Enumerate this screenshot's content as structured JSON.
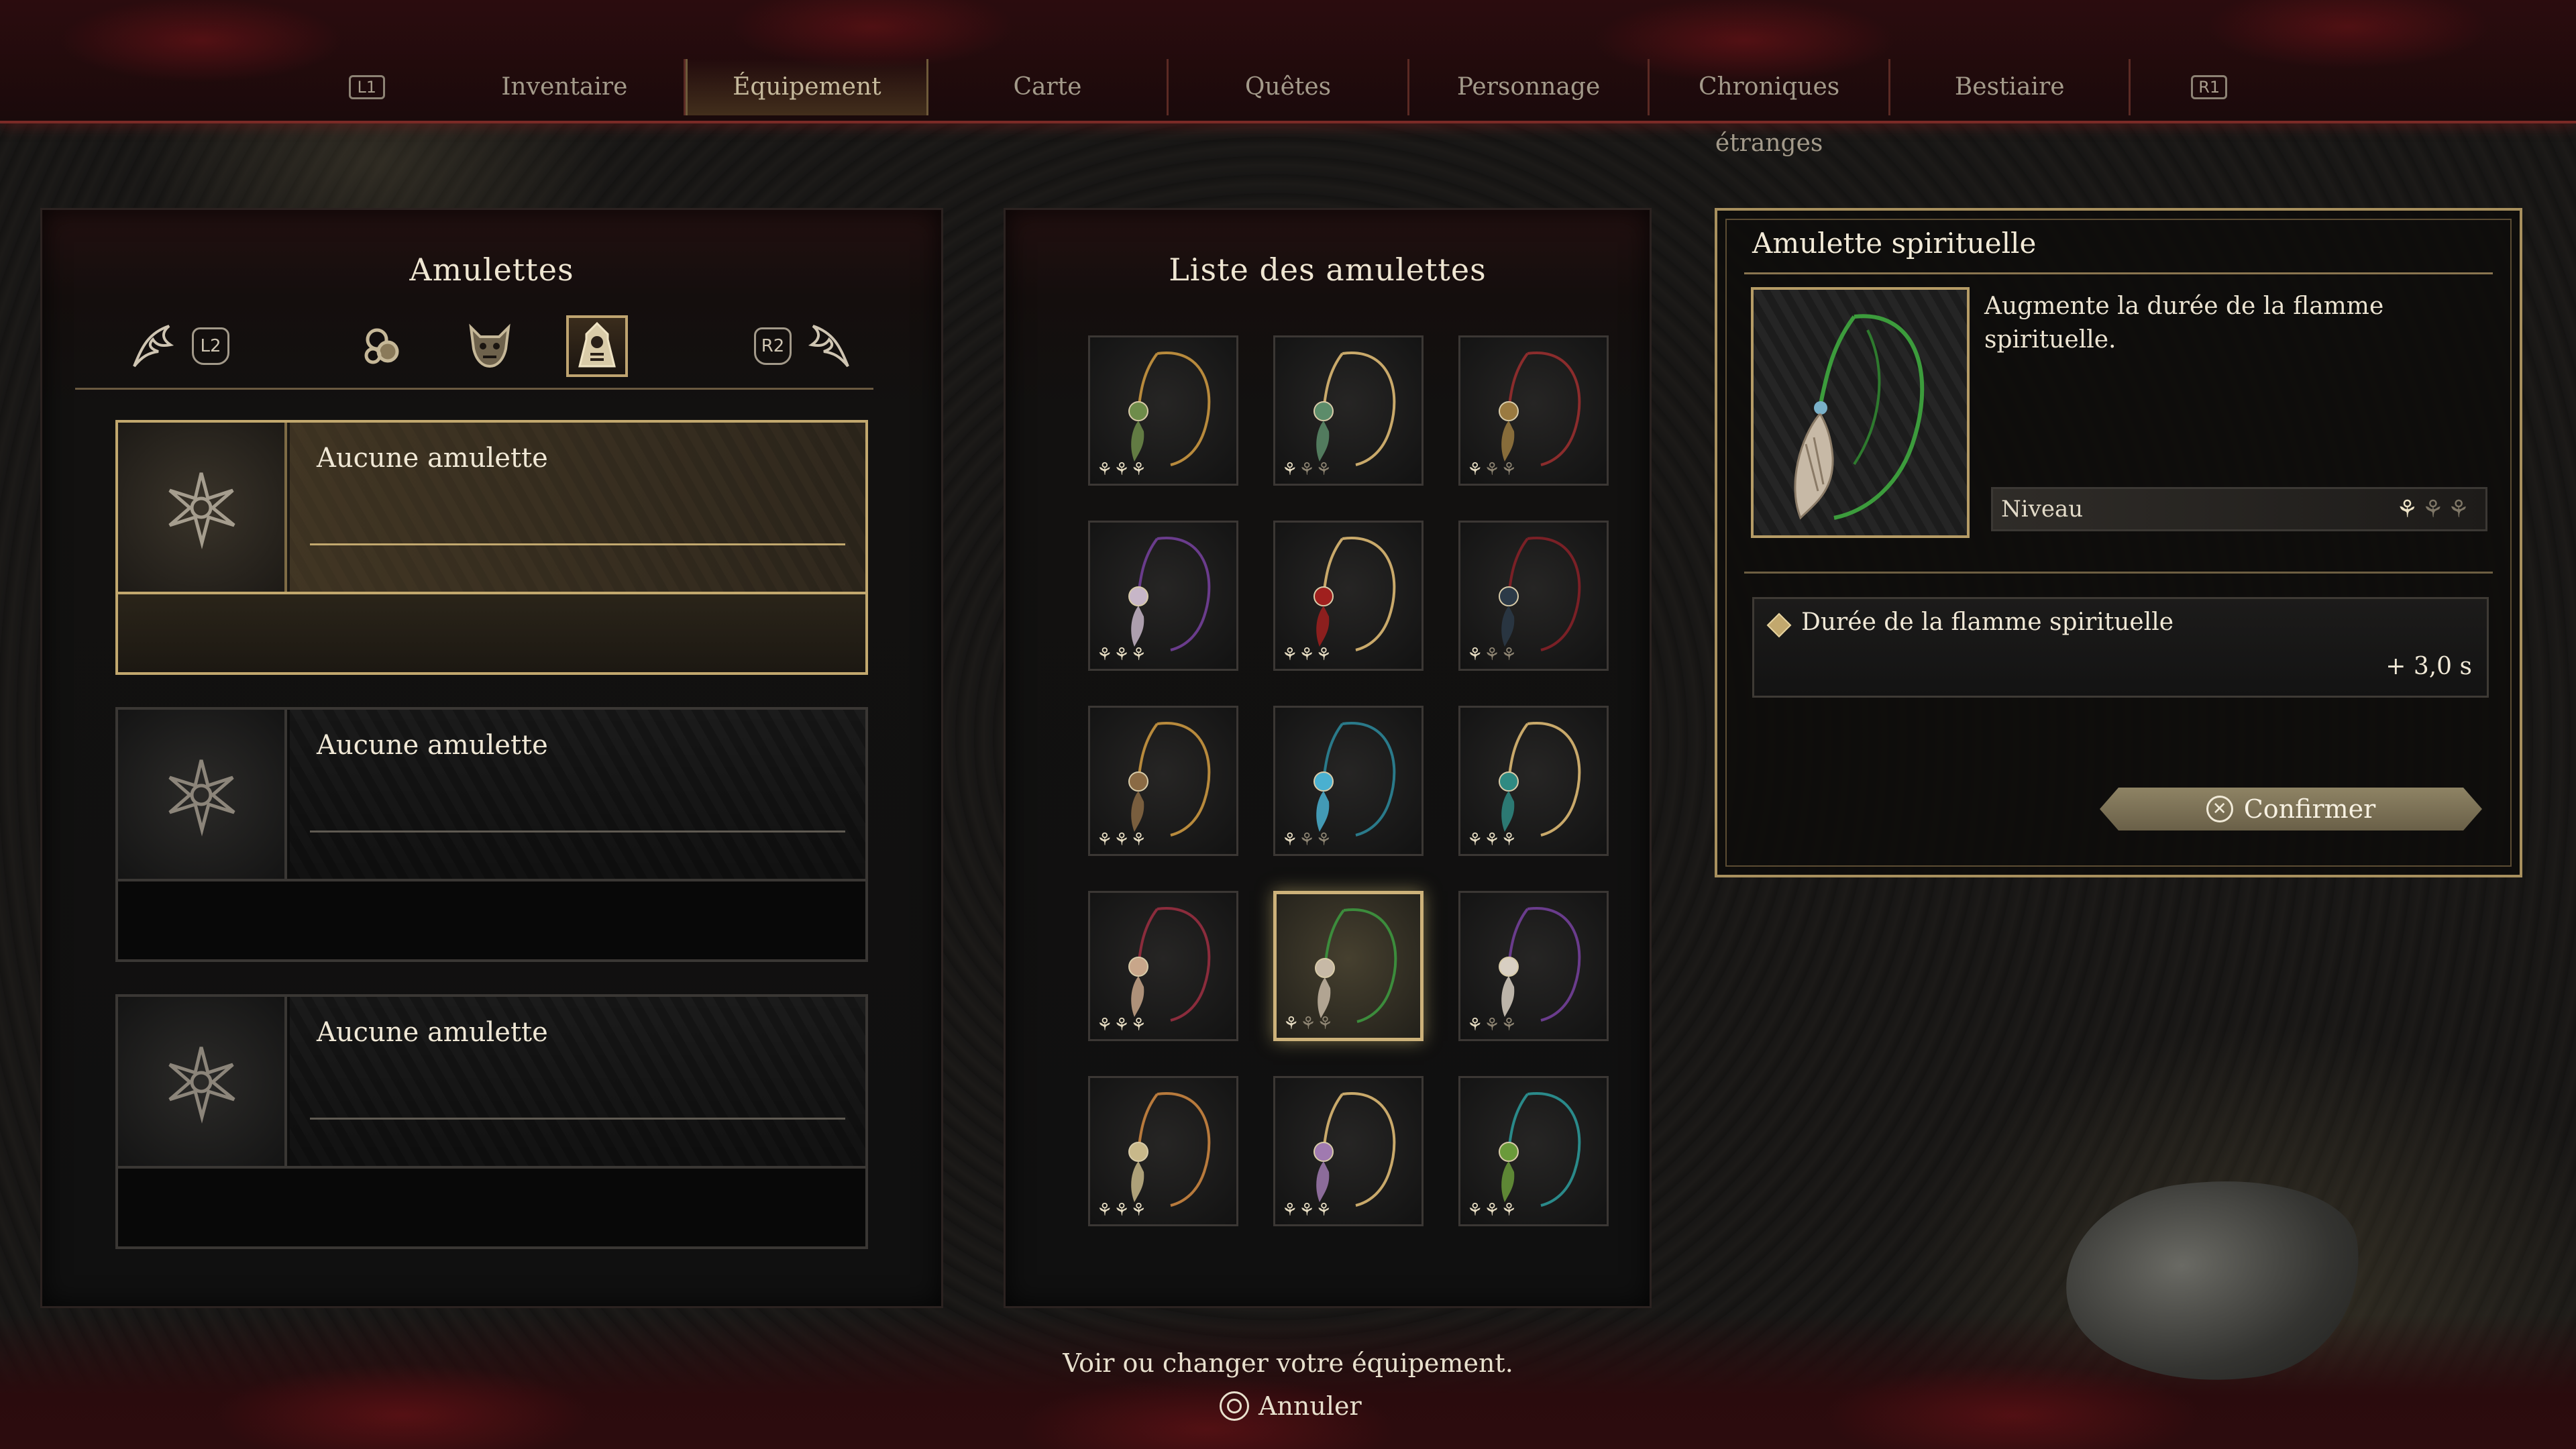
{
  "nav": {
    "left_hint": "L1",
    "right_hint": "R1",
    "tabs": [
      "Inventaire",
      "Équipement",
      "Carte",
      "Quêtes",
      "Personnage",
      "Chroniques étranges",
      "Bestiaire"
    ],
    "active_tab": "Équipement"
  },
  "left_panel": {
    "title": "Amulettes",
    "prev_hint": "L2",
    "next_hint": "R2",
    "categories": [
      "talisman-category-icon",
      "mask-category-icon",
      "amulet-category-icon"
    ],
    "active_category": "amulet-category-icon",
    "slots": [
      {
        "name": "Aucune amulette",
        "selected": true
      },
      {
        "name": "Aucune amulette",
        "selected": false
      },
      {
        "name": "Aucune amulette",
        "selected": false
      }
    ]
  },
  "mid_panel": {
    "title": "Liste des amulettes",
    "items": [
      {
        "icon": "green-orb-amulet-icon",
        "cord": "#b88a3c",
        "charm": "#6e8c4a",
        "level": 3
      },
      {
        "icon": "green-pouch-amulet-icon",
        "cord": "#c9a96a",
        "charm": "#5c8c6a",
        "level": 1
      },
      {
        "icon": "spiral-amulet-icon",
        "cord": "#8b2c2c",
        "charm": "#9a7a40",
        "level": 1
      },
      {
        "icon": "purple-bead-amulet-icon",
        "cord": "#6a3c8c",
        "charm": "#c7b6c8",
        "level": 3
      },
      {
        "icon": "red-orb-amulet-icon",
        "cord": "#c9a96a",
        "charm": "#a0201e",
        "level": 3
      },
      {
        "icon": "dark-feather-amulet-icon",
        "cord": "#7a2026",
        "charm": "#2c3a48",
        "level": 1
      },
      {
        "icon": "brown-pouch-amulet-icon",
        "cord": "#b88a3c",
        "charm": "#8a6a44",
        "level": 3
      },
      {
        "icon": "blue-feather-amulet-icon",
        "cord": "#2a7a8a",
        "charm": "#4ab0d0",
        "level": 1
      },
      {
        "icon": "teal-orb-amulet-icon",
        "cord": "#c9a96a",
        "charm": "#2f8a82",
        "level": 3
      },
      {
        "icon": "fox-tail-red-amulet-icon",
        "cord": "#8b2c3c",
        "charm": "#c8a68a",
        "level": 3
      },
      {
        "icon": "fox-tail-green-amulet-icon",
        "cord": "#3c8c3c",
        "charm": "#c7b9a6",
        "level": 1
      },
      {
        "icon": "fox-tail-purple-amulet-icon",
        "cord": "#6a3c8c",
        "charm": "#d8cfc2",
        "level": 1
      },
      {
        "icon": "wheat-amulet-icon",
        "cord": "#b87a3c",
        "charm": "#c8b88a",
        "level": 3
      },
      {
        "icon": "violet-tassel-amulet-icon",
        "cord": "#c9a96a",
        "charm": "#a07ab0",
        "level": 3
      },
      {
        "icon": "green-spiral-amulet-icon",
        "cord": "#2a8a8a",
        "charm": "#6a9a3a",
        "level": 3
      }
    ],
    "selected_index": 10
  },
  "detail": {
    "title": "Amulette spirituelle",
    "description": "Augmente la durée de la flamme spirituelle.",
    "level_label": "Niveau",
    "level": 1,
    "level_max": 3,
    "stat_name": "Durée de la flamme spirituelle",
    "stat_value": "+ 3,0 s",
    "confirm_label": "Confirmer",
    "confirm_hint_icon": "cross-button-icon"
  },
  "footer": {
    "hint": "Voir ou changer votre équipement.",
    "cancel_label": "Annuler",
    "cancel_icon": "circle-button-icon"
  }
}
